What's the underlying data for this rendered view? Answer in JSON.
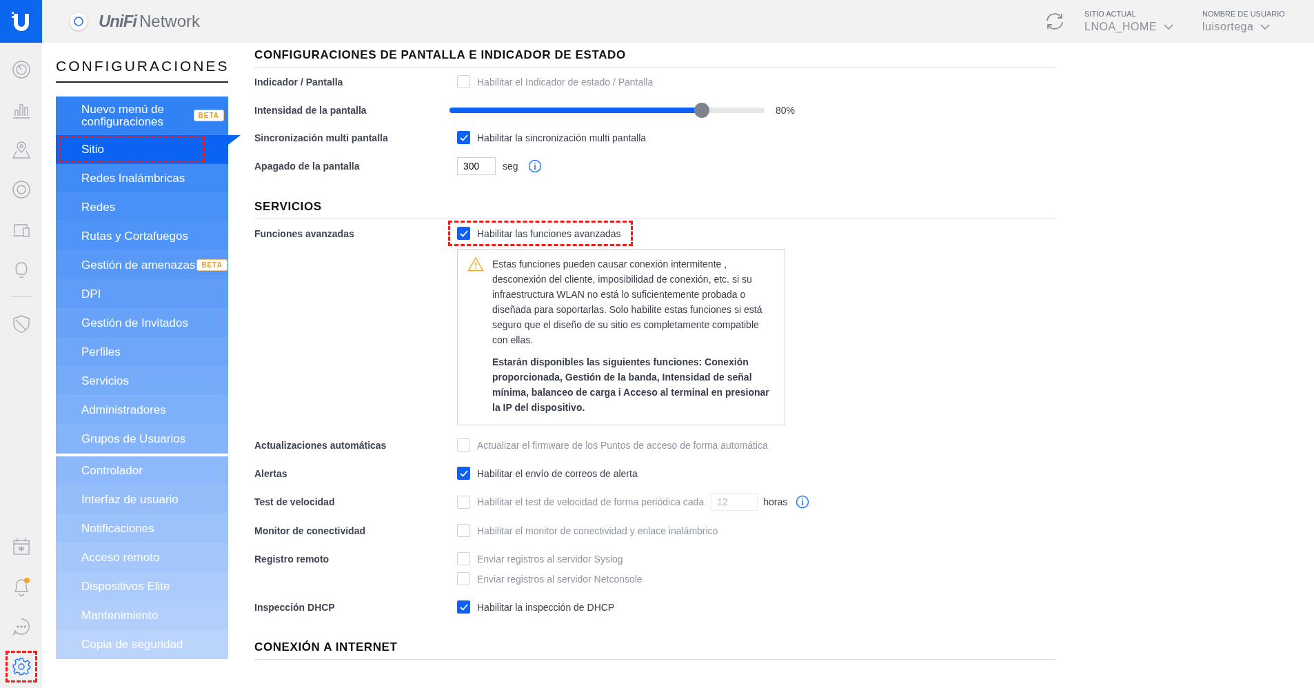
{
  "header": {
    "brand": "UniFi",
    "product": "Network",
    "site": {
      "label": "SITIO ACTUAL",
      "value": "LNOA_HOME"
    },
    "user": {
      "label": "NOMBRE DE USUARIO",
      "value": "luisortega"
    }
  },
  "rail": {
    "top": [
      {
        "kind": "dashboard"
      },
      {
        "kind": "stats"
      },
      {
        "kind": "map"
      },
      {
        "kind": "devices"
      },
      {
        "kind": "clients"
      },
      {
        "kind": "insights"
      },
      {
        "kind": "divider"
      },
      {
        "kind": "shield"
      }
    ],
    "bottom": [
      {
        "kind": "events",
        "selected": false,
        "highlighted": false
      },
      {
        "kind": "alerts",
        "selected": false,
        "highlighted": false,
        "dot": true
      },
      {
        "kind": "chat",
        "selected": false,
        "highlighted": false
      },
      {
        "kind": "settings",
        "selected": true,
        "highlighted": true
      }
    ]
  },
  "sidebar": {
    "title": "CONFIGURACIONES",
    "groups": [
      [
        {
          "label": "Nuevo menú de configuraciones",
          "badge": "BETA",
          "selected": false,
          "highlighted": false
        },
        {
          "label": "Sitio",
          "selected": true,
          "highlighted": true
        },
        {
          "label": "Redes Inalámbricas",
          "selected": false,
          "highlighted": false
        },
        {
          "label": "Redes",
          "selected": false,
          "highlighted": false
        },
        {
          "label": "Rutas y Cortafuegos",
          "selected": false,
          "highlighted": false
        },
        {
          "label": "Gestión de amenazas",
          "badge": "BETA",
          "selected": false,
          "highlighted": false
        },
        {
          "label": "DPI",
          "selected": false,
          "highlighted": false
        },
        {
          "label": "Gestión de Invitados",
          "selected": false,
          "highlighted": false
        },
        {
          "label": "Perfiles",
          "selected": false,
          "highlighted": false
        },
        {
          "label": "Servicios",
          "selected": false,
          "highlighted": false
        },
        {
          "label": "Administradores",
          "selected": false,
          "highlighted": false
        },
        {
          "label": "Grupos de Usuarios",
          "selected": false,
          "highlighted": false
        }
      ],
      [
        {
          "label": "Controlador",
          "selected": false,
          "highlighted": false
        },
        {
          "label": "Interfaz de usuario",
          "selected": false,
          "highlighted": false
        },
        {
          "label": "Notificaciones",
          "selected": false,
          "highlighted": false
        },
        {
          "label": "Acceso remoto",
          "selected": false,
          "highlighted": false
        },
        {
          "label": "Dispositivos Elite",
          "selected": false,
          "highlighted": false
        },
        {
          "label": "Mantenimiento",
          "selected": false,
          "highlighted": false
        },
        {
          "label": "Copia de seguridad",
          "selected": false,
          "highlighted": false
        }
      ]
    ]
  },
  "sections": [
    {
      "title": "CONFIGURACIONES DE PANTALLA E INDICADOR DE ESTADO",
      "rows": [
        {
          "kind": "checkbox",
          "label": "Indicador / Pantalla",
          "options": [
            {
              "text": "Habilitar el Indicador de estado / Pantalla",
              "checked": false,
              "highlighted": false
            }
          ]
        },
        {
          "kind": "slider",
          "label": "Intensidad de la pantalla",
          "level": 0.8,
          "reading": "80%"
        },
        {
          "kind": "checkbox",
          "label": "Sincronización multi pantalla",
          "options": [
            {
              "text": "Habilitar la sincronización multi pantalla",
              "checked": true,
              "highlighted": false
            }
          ]
        },
        {
          "kind": "number",
          "label": "Apagado de la pantalla",
          "value": "300",
          "unit": "seg",
          "disabled": false
        }
      ]
    },
    {
      "title": "SERVICIOS",
      "rows": [
        {
          "kind": "checkbox",
          "label": "Funciones avanzadas",
          "options": [
            {
              "text": "Habilitar las funciones avanzadas",
              "checked": true,
              "highlighted": true
            }
          ],
          "warning": {
            "text": "Estas funciones pueden causar conexión intermitente , desconexión del cliente, imposibilidad de conexión, etc. si su infraestructura WLAN no está lo suficientemente probada o diseñada para soportarlas. Solo habilite estas funciones si está seguro que el diseño de su sitio es completamente compatible con ellas.",
            "bold_text": "Estarán disponibles las siguientes funciones: Conexión proporcionada, Gestión de la banda, Intensidad de señal mínima, balanceo de carga i Acceso al terminal en presionar la IP del dispositivo."
          }
        },
        {
          "kind": "checkbox",
          "label": "Actualizaciones automáticas",
          "options": [
            {
              "text": "Actualizar el firmware de los Puntos de acceso de forma automática",
              "checked": false,
              "highlighted": false
            }
          ]
        },
        {
          "kind": "checkbox",
          "label": "Alertas",
          "options": [
            {
              "text": "Habilitar el envío de correos de alerta",
              "checked": true,
              "highlighted": false
            }
          ]
        },
        {
          "kind": "checkbox-number",
          "label": "Test de velocidad",
          "options": [
            {
              "text": "Habilitar el test de velocidad de forma periódica cada",
              "checked": false,
              "highlighted": false
            }
          ],
          "value": "12",
          "unit": "horas",
          "disabled": true
        },
        {
          "kind": "checkbox",
          "label": "Monitor de conectividad",
          "options": [
            {
              "text": "Habilitar el monitor de conectividad y enlace inalámbrico",
              "checked": false,
              "highlighted": false
            }
          ]
        },
        {
          "kind": "checkbox",
          "label": "Registro remoto",
          "options": [
            {
              "text": "Enviar registros al servidor Syslog",
              "checked": false,
              "highlighted": false
            },
            {
              "text": "Enviar registros al servidor Netconsole",
              "checked": false,
              "highlighted": false
            }
          ]
        },
        {
          "kind": "checkbox",
          "label": "Inspección DHCP",
          "options": [
            {
              "text": "Habilitar la inspección de DHCP",
              "checked": true,
              "highlighted": false
            }
          ]
        }
      ]
    },
    {
      "title": "CONEXIÓN A INTERNET"
    }
  ]
}
